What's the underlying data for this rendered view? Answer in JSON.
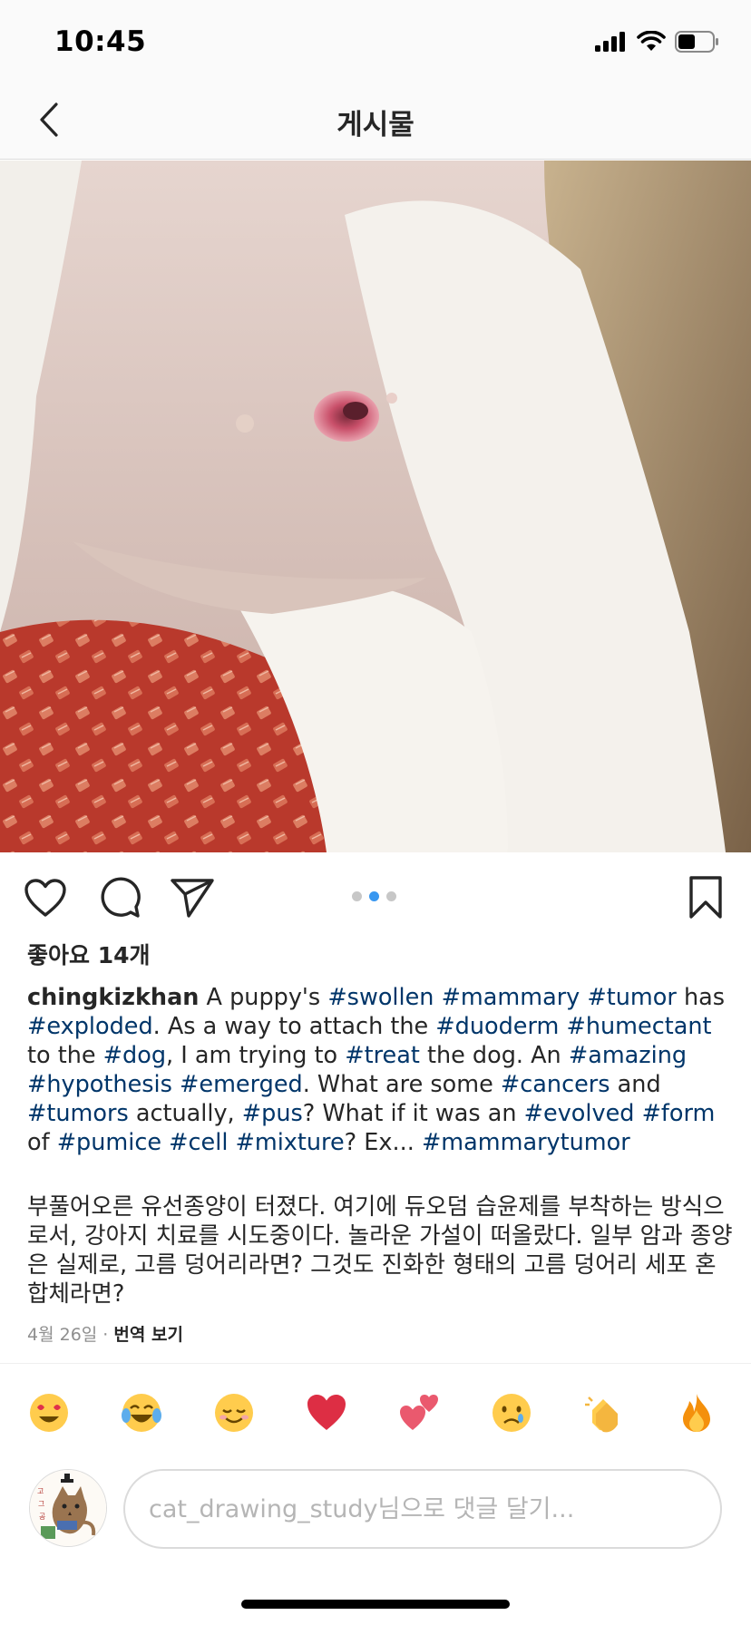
{
  "status": {
    "time": "10:45",
    "battery_color": "#000000"
  },
  "nav": {
    "title": "게시물",
    "back_icon": "chevron-left-icon"
  },
  "post": {
    "photo_alt": "",
    "likes": "좋아요 14개",
    "carousel": {
      "count": 3,
      "active": 1,
      "active_color": "#3897f0"
    },
    "caption": {
      "username": "chingkizkhan",
      "segments": [
        {
          "t": " A puppy's "
        },
        {
          "h": "#swollen"
        },
        {
          "t": " "
        },
        {
          "h": "#mammary"
        },
        {
          "t": " "
        },
        {
          "h": "#tumor"
        },
        {
          "t": " has "
        },
        {
          "h": "#exploded"
        },
        {
          "t": ". As a way to attach the "
        },
        {
          "h": "#duoderm"
        },
        {
          "t": " "
        },
        {
          "h": "#humectant"
        },
        {
          "t": " to the "
        },
        {
          "h": "#dog"
        },
        {
          "t": ", I am trying to "
        },
        {
          "h": "#treat"
        },
        {
          "t": " the dog. An "
        },
        {
          "h": "#amazing"
        },
        {
          "t": " "
        },
        {
          "h": "#hypothesis"
        },
        {
          "t": " "
        },
        {
          "h": "#emerged"
        },
        {
          "t": ". What are some "
        },
        {
          "h": "#cancers"
        },
        {
          "t": " and "
        },
        {
          "h": "#tumors"
        },
        {
          "t": " actually, "
        },
        {
          "h": "#pus"
        },
        {
          "t": "? What if it was an "
        },
        {
          "h": "#evolved"
        },
        {
          "t": " "
        },
        {
          "h": "#form"
        },
        {
          "t": " of "
        },
        {
          "h": "#pumice"
        },
        {
          "t": " "
        },
        {
          "h": "#cell"
        },
        {
          "t": " "
        },
        {
          "h": "#mixture"
        },
        {
          "t": "? Ex... "
        },
        {
          "h": "#mammarytumor"
        }
      ],
      "hashtag_color": "#003569"
    },
    "translation_text": "부풀어오른 유선종양이 터졌다. 여기에 듀오덤 습윤제를 부착하는 방식으로서, 강아지 치료를 시도중이다. 놀라운 가설이 떠올랐다. 일부 암과 종양은 실제로, 고름 덩어리라면? 그것도 진화한 형태의 고름 덩어리 세포 혼합체라면?",
    "date": "4월 26일",
    "separator": " · ",
    "translate_link": "번역 보기"
  },
  "actions": {
    "like_icon": "heart-outline-icon",
    "comment_icon": "comment-bubble-icon",
    "share_icon": "paper-plane-icon",
    "save_icon": "bookmark-outline-icon"
  },
  "emoji_bar": [
    "😍",
    "😂",
    "☺️",
    "❤️",
    "💕",
    "😢",
    "👏",
    "🔥"
  ],
  "comment": {
    "placeholder": "cat_drawing_study님으로 댓글 달기...",
    "avatar_icon": "cat-drawing-avatar"
  }
}
